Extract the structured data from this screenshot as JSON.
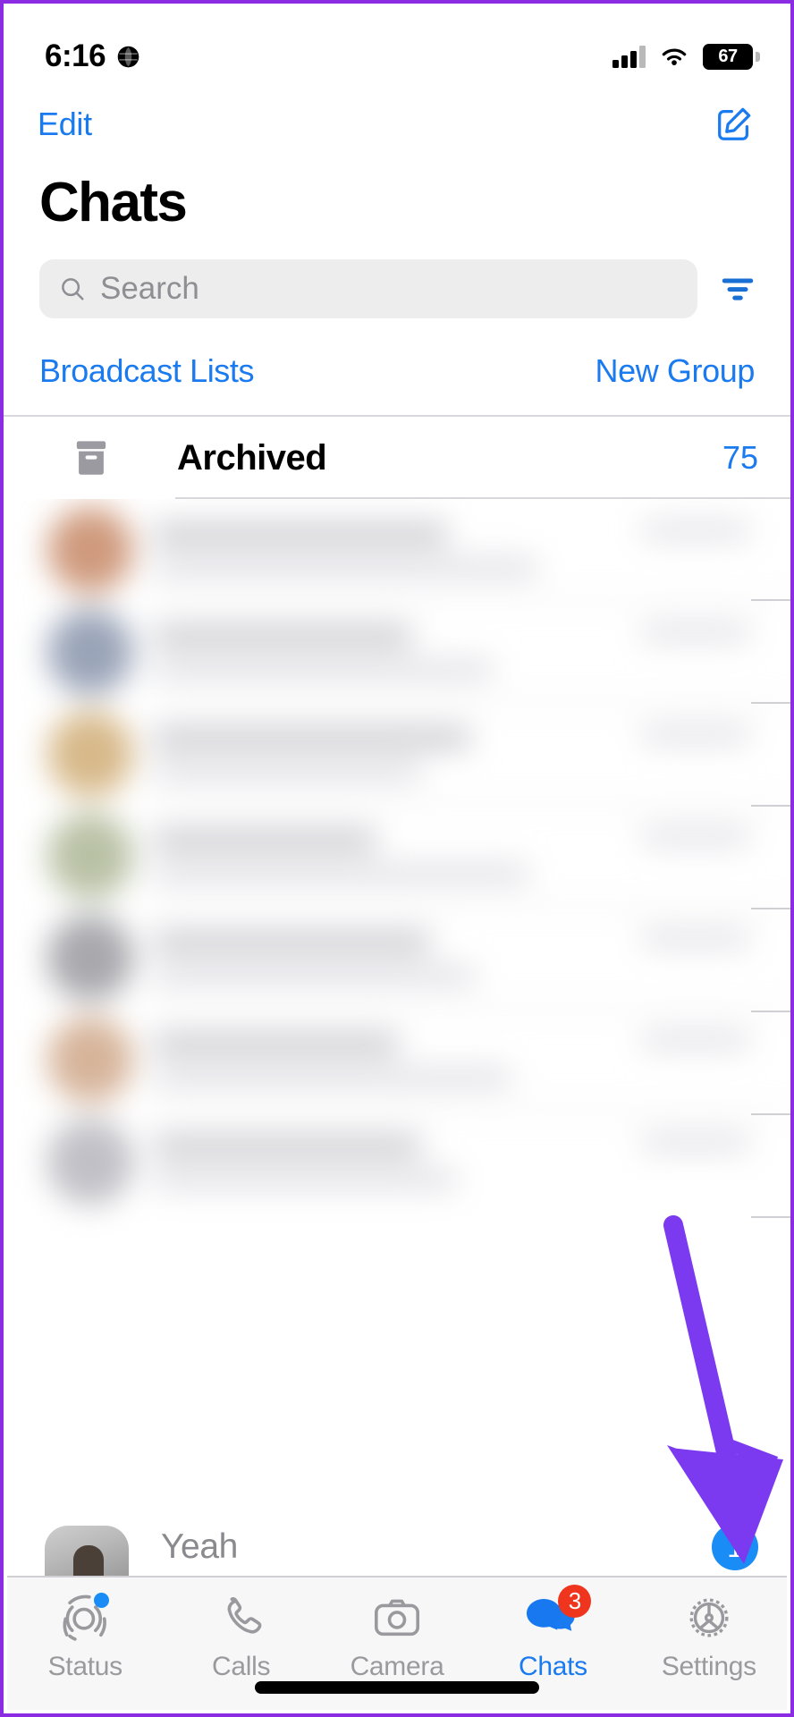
{
  "status_bar": {
    "time": "6:16",
    "globe_icon": "globe-icon",
    "signal_icon": "cellular-signal-icon",
    "wifi_icon": "wifi-icon",
    "battery_level": "67"
  },
  "nav": {
    "edit_label": "Edit",
    "compose_icon": "compose-new-chat-icon"
  },
  "header": {
    "title": "Chats"
  },
  "search": {
    "placeholder": "Search",
    "value": "",
    "search_icon": "search-icon",
    "filter_icon": "filter-icon"
  },
  "quick_links": {
    "broadcast_label": "Broadcast Lists",
    "new_group_label": "New Group"
  },
  "archived": {
    "icon": "archive-box-icon",
    "label": "Archived",
    "count": "75"
  },
  "chat_list": {
    "blurred": true,
    "rows": [
      {
        "avatar_color": "#cf9a7d"
      },
      {
        "avatar_color": "#9aa4b8"
      },
      {
        "avatar_color": "#d7b98a"
      },
      {
        "avatar_color": "#b9c1a5"
      },
      {
        "avatar_color": "#a8a8ad"
      },
      {
        "avatar_color": "#d6b49a"
      },
      {
        "avatar_color": "#c0c0c6"
      }
    ],
    "partial_row": {
      "message": "Yeah",
      "avatar": "contact-avatar"
    },
    "unread_badge": "1"
  },
  "tab_bar": {
    "tabs": [
      {
        "label": "Status",
        "icon": "status-rings-icon",
        "active": false,
        "dot": true,
        "badge": ""
      },
      {
        "label": "Calls",
        "icon": "phone-icon",
        "active": false,
        "dot": false,
        "badge": ""
      },
      {
        "label": "Camera",
        "icon": "camera-icon",
        "active": false,
        "dot": false,
        "badge": ""
      },
      {
        "label": "Chats",
        "icon": "chat-bubbles-icon",
        "active": true,
        "dot": false,
        "badge": "3"
      },
      {
        "label": "Settings",
        "icon": "gear-icon",
        "active": false,
        "dot": false,
        "badge": ""
      }
    ]
  },
  "annotation": {
    "arrow_icon": "purple-down-arrow",
    "arrow_color": "#7C3AF0"
  },
  "colors": {
    "accent_blue": "#1a7aef",
    "badge_red": "#f0351f",
    "badge_blue": "#1a8cf5",
    "frame_purple": "#8B2BE2",
    "search_bg": "#ededee",
    "tabbar_bg": "#f7f7f8"
  }
}
